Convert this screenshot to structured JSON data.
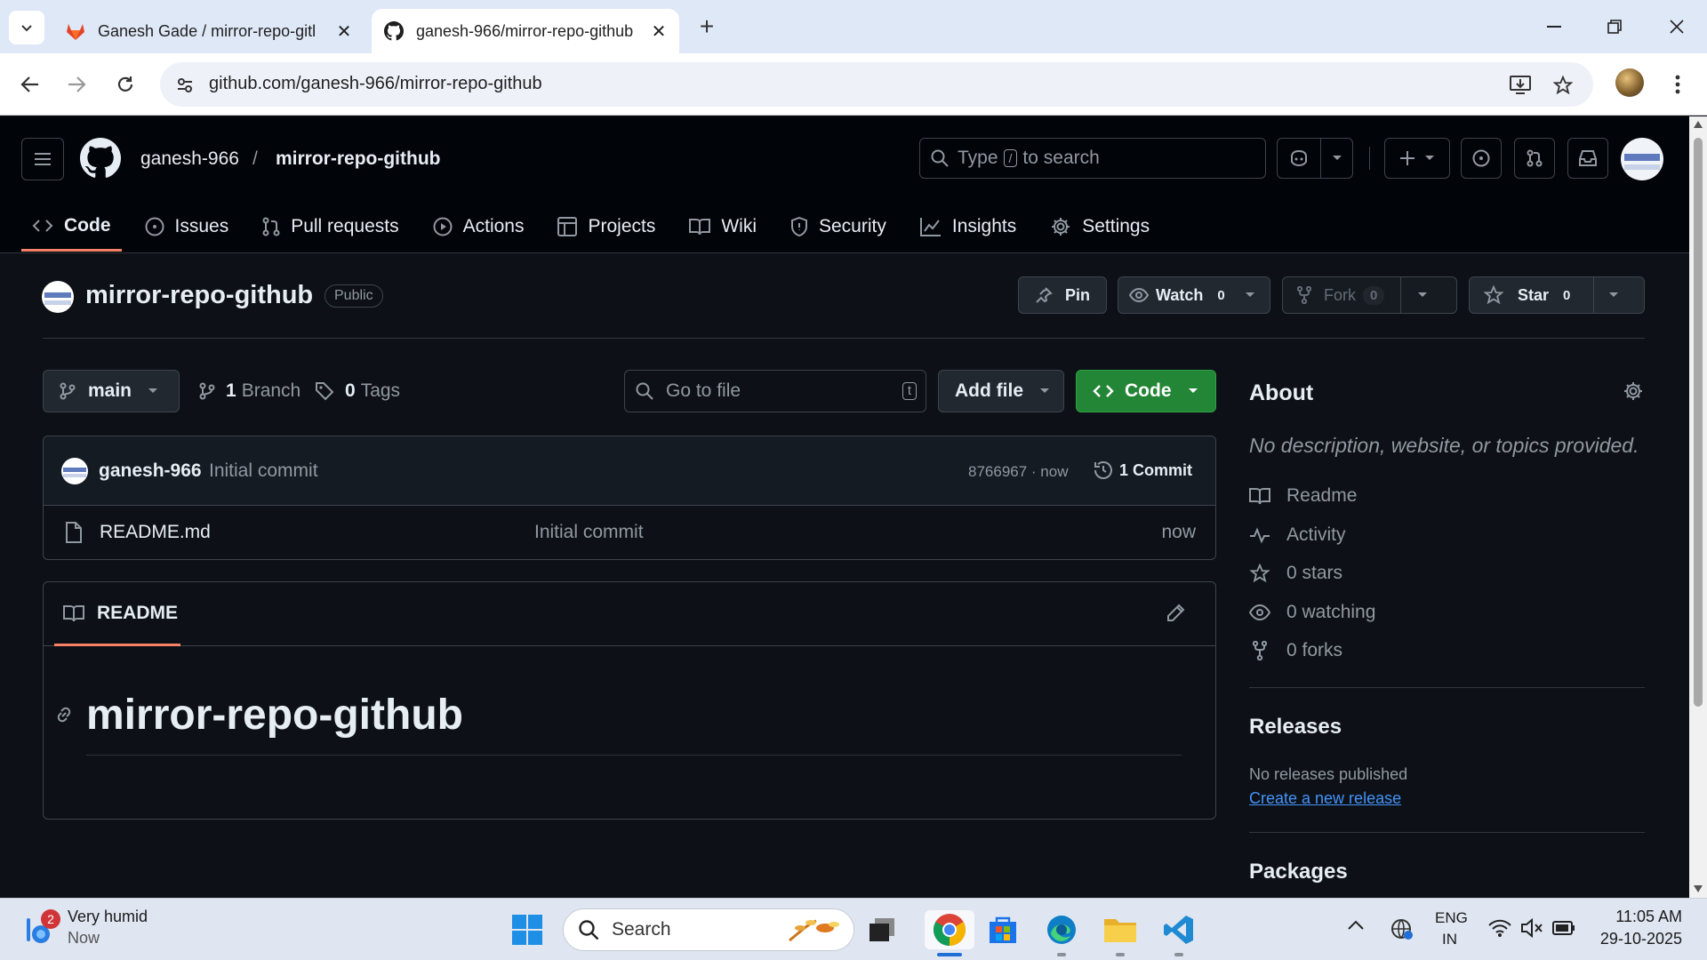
{
  "browser": {
    "tabs": [
      {
        "title": "Ganesh Gade / mirror-repo-gitl",
        "active": false
      },
      {
        "title": "ganesh-966/mirror-repo-github",
        "active": true
      }
    ],
    "new_tab": "+",
    "url": "github.com/ganesh-966/mirror-repo-github"
  },
  "header": {
    "owner": "ganesh-966",
    "separator": "/",
    "repo": "mirror-repo-github",
    "search_prefix": "Type",
    "search_key": "/",
    "search_suffix": "to search"
  },
  "nav": {
    "tabs": [
      {
        "label": "Code",
        "icon": "code-icon",
        "active": true
      },
      {
        "label": "Issues",
        "icon": "issue-icon"
      },
      {
        "label": "Pull requests",
        "icon": "pull-request-icon"
      },
      {
        "label": "Actions",
        "icon": "play-icon"
      },
      {
        "label": "Projects",
        "icon": "table-icon"
      },
      {
        "label": "Wiki",
        "icon": "book-icon"
      },
      {
        "label": "Security",
        "icon": "shield-icon"
      },
      {
        "label": "Insights",
        "icon": "graph-icon"
      },
      {
        "label": "Settings",
        "icon": "gear-icon"
      }
    ]
  },
  "repo": {
    "name": "mirror-repo-github",
    "visibility": "Public",
    "pin_label": "Pin",
    "watch_label": "Watch",
    "watch_count": "0",
    "fork_label": "Fork",
    "fork_count": "0",
    "star_label": "Star",
    "star_count": "0"
  },
  "toolbar": {
    "branch": "main",
    "branches": "1 Branch",
    "branches_num": "1",
    "branches_word": "Branch",
    "tags_num": "0",
    "tags_word": "Tags",
    "go_to_file": "Go to file",
    "go_to_file_key": "t",
    "add_file": "Add file",
    "code": "Code"
  },
  "latest_commit": {
    "author": "ganesh-966",
    "message": "Initial commit",
    "sha": "8766967 · now",
    "commits": "1 Commit"
  },
  "files": [
    {
      "name": "README.md",
      "message": "Initial commit",
      "time": "now"
    }
  ],
  "readme": {
    "tab_label": "README",
    "heading": "mirror-repo-github"
  },
  "about": {
    "title": "About",
    "description": "No description, website, or topics provided.",
    "items": [
      {
        "label": "Readme",
        "icon": "book-icon"
      },
      {
        "label": "Activity",
        "icon": "pulse-icon"
      },
      {
        "label": "0 stars",
        "icon": "star-icon"
      },
      {
        "label": "0 watching",
        "icon": "eye-icon"
      },
      {
        "label": "0 forks",
        "icon": "fork-icon"
      }
    ]
  },
  "releases": {
    "title": "Releases",
    "none_text": "No releases published",
    "create_link": "Create a new release"
  },
  "packages": {
    "title": "Packages"
  },
  "taskbar": {
    "weather_badge": "2",
    "weather_title": "Very humid",
    "weather_sub": "Now",
    "search": "Search",
    "lang_top": "ENG",
    "lang_bottom": "IN",
    "time": "11:05 AM",
    "date": "29-10-2025"
  },
  "colors": {
    "accent_green": "#238636",
    "tab_underline": "#f78166",
    "link_blue": "#4493f8"
  }
}
